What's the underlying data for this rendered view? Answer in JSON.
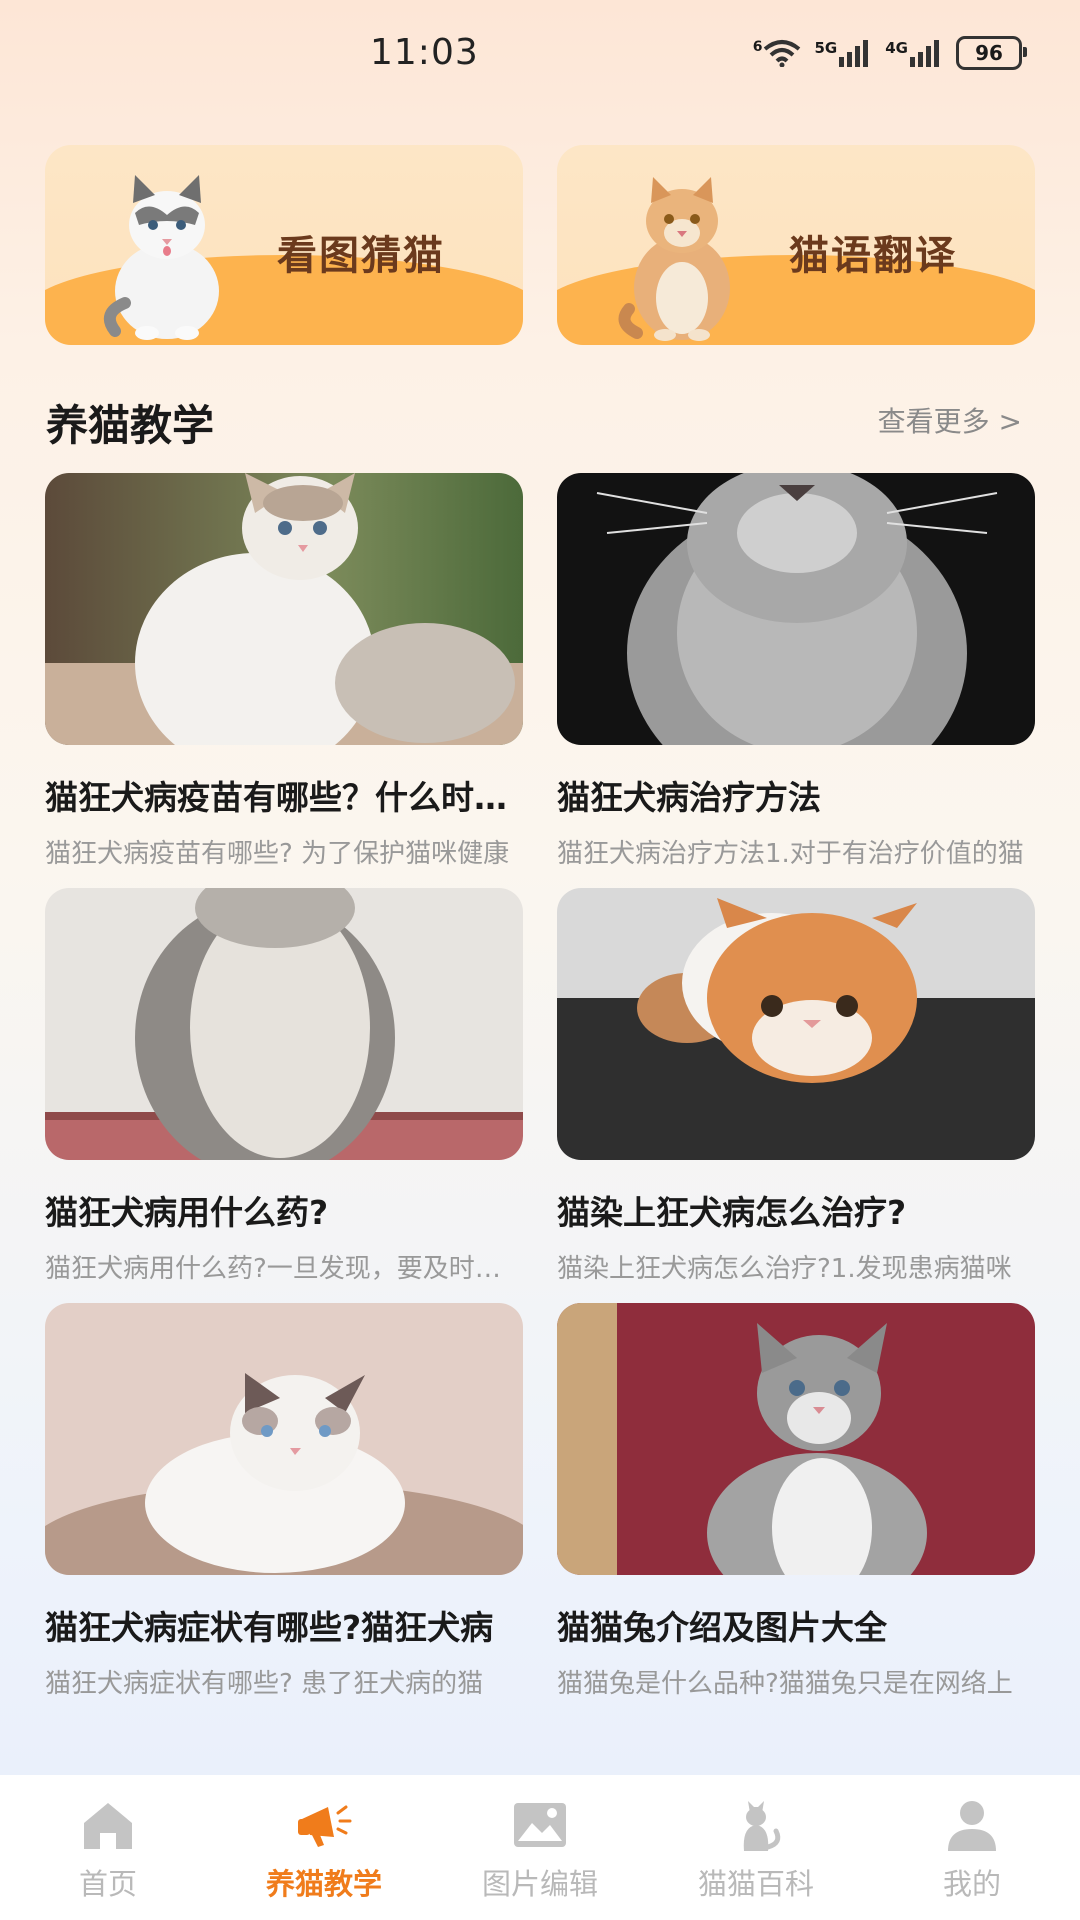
{
  "status_bar": {
    "time": "11:03",
    "wifi": "6",
    "net1": "5G",
    "net2": "4G",
    "battery": "96"
  },
  "features": [
    {
      "label": "看图猜猫",
      "icon": "ragdoll-cat-image"
    },
    {
      "label": "猫语翻译",
      "icon": "orange-cat-image"
    }
  ],
  "section": {
    "title": "养猫教学",
    "more": "查看更多 >"
  },
  "articles": [
    {
      "title": "猫狂犬病疫苗有哪些？什么时候打",
      "desc": "猫狂犬病疫苗有哪些? 为了保护猫咪健康"
    },
    {
      "title": "猫狂犬病治疗方法",
      "desc": "猫狂犬病治疗方法1.对于有治疗价值的猫"
    },
    {
      "title": "猫狂犬病用什么药?",
      "desc": "猫狂犬病用什么药?一旦发现，要及时处理"
    },
    {
      "title": "猫染上狂犬病怎么治疗?",
      "desc": "猫染上狂犬病怎么治疗?1.发现患病猫咪"
    },
    {
      "title": "猫狂犬病症状有哪些?猫狂犬病",
      "desc": "猫狂犬病症状有哪些? 患了狂犬病的猫"
    },
    {
      "title": "猫猫兔介绍及图片大全",
      "desc": "猫猫兔是什么品种?猫猫兔只是在网络上"
    }
  ],
  "tabs": [
    {
      "label": "首页",
      "icon": "home-icon",
      "active": false
    },
    {
      "label": "养猫教学",
      "icon": "megaphone-icon",
      "active": true
    },
    {
      "label": "图片编辑",
      "icon": "image-icon",
      "active": false
    },
    {
      "label": "猫猫百科",
      "icon": "cat-icon",
      "active": false
    },
    {
      "label": "我的",
      "icon": "user-icon",
      "active": false
    }
  ],
  "colors": {
    "accent": "#f07c1b",
    "card_wave": "#fdb34e",
    "feature_text": "#6b3a1d"
  }
}
